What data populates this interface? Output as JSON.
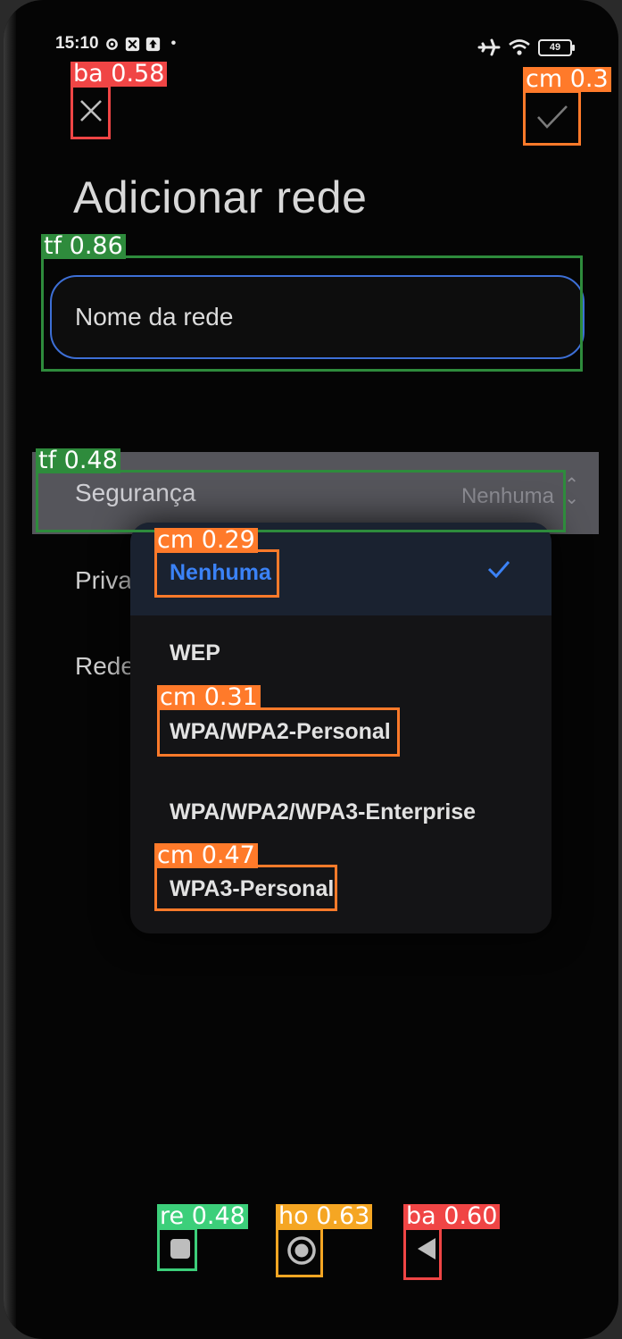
{
  "status_bar": {
    "time": "15:10",
    "battery": "49"
  },
  "page": {
    "title": "Adicionar rede"
  },
  "name_field": {
    "placeholder": "Nome da rede"
  },
  "security": {
    "label": "Segurança",
    "value": "Nenhuma"
  },
  "rows": {
    "privacy_partial": "Priva",
    "network_partial": "Rede"
  },
  "security_options": [
    {
      "label": "Nenhuma",
      "selected": true
    },
    {
      "label": "WEP",
      "selected": false
    },
    {
      "label": "WPA/WPA2-Personal",
      "selected": false
    },
    {
      "label": "WPA/WPA2/WPA3-Enterprise",
      "selected": false
    },
    {
      "label": "WPA3-Personal",
      "selected": false
    }
  ],
  "detections": [
    {
      "label": "ba 0.58"
    },
    {
      "label": "cm 0.3"
    },
    {
      "label": "tf 0.86"
    },
    {
      "label": "tf 0.48"
    },
    {
      "label": "cm 0.29"
    },
    {
      "label": "cm 0.31"
    },
    {
      "label": "cm 0.47"
    },
    {
      "label": "re 0.48"
    },
    {
      "label": "ho 0.63"
    },
    {
      "label": "ba 0.60"
    }
  ],
  "colors": {
    "accent": "#3b82f6",
    "field_border": "#3d6fd6",
    "background": "#050505"
  }
}
